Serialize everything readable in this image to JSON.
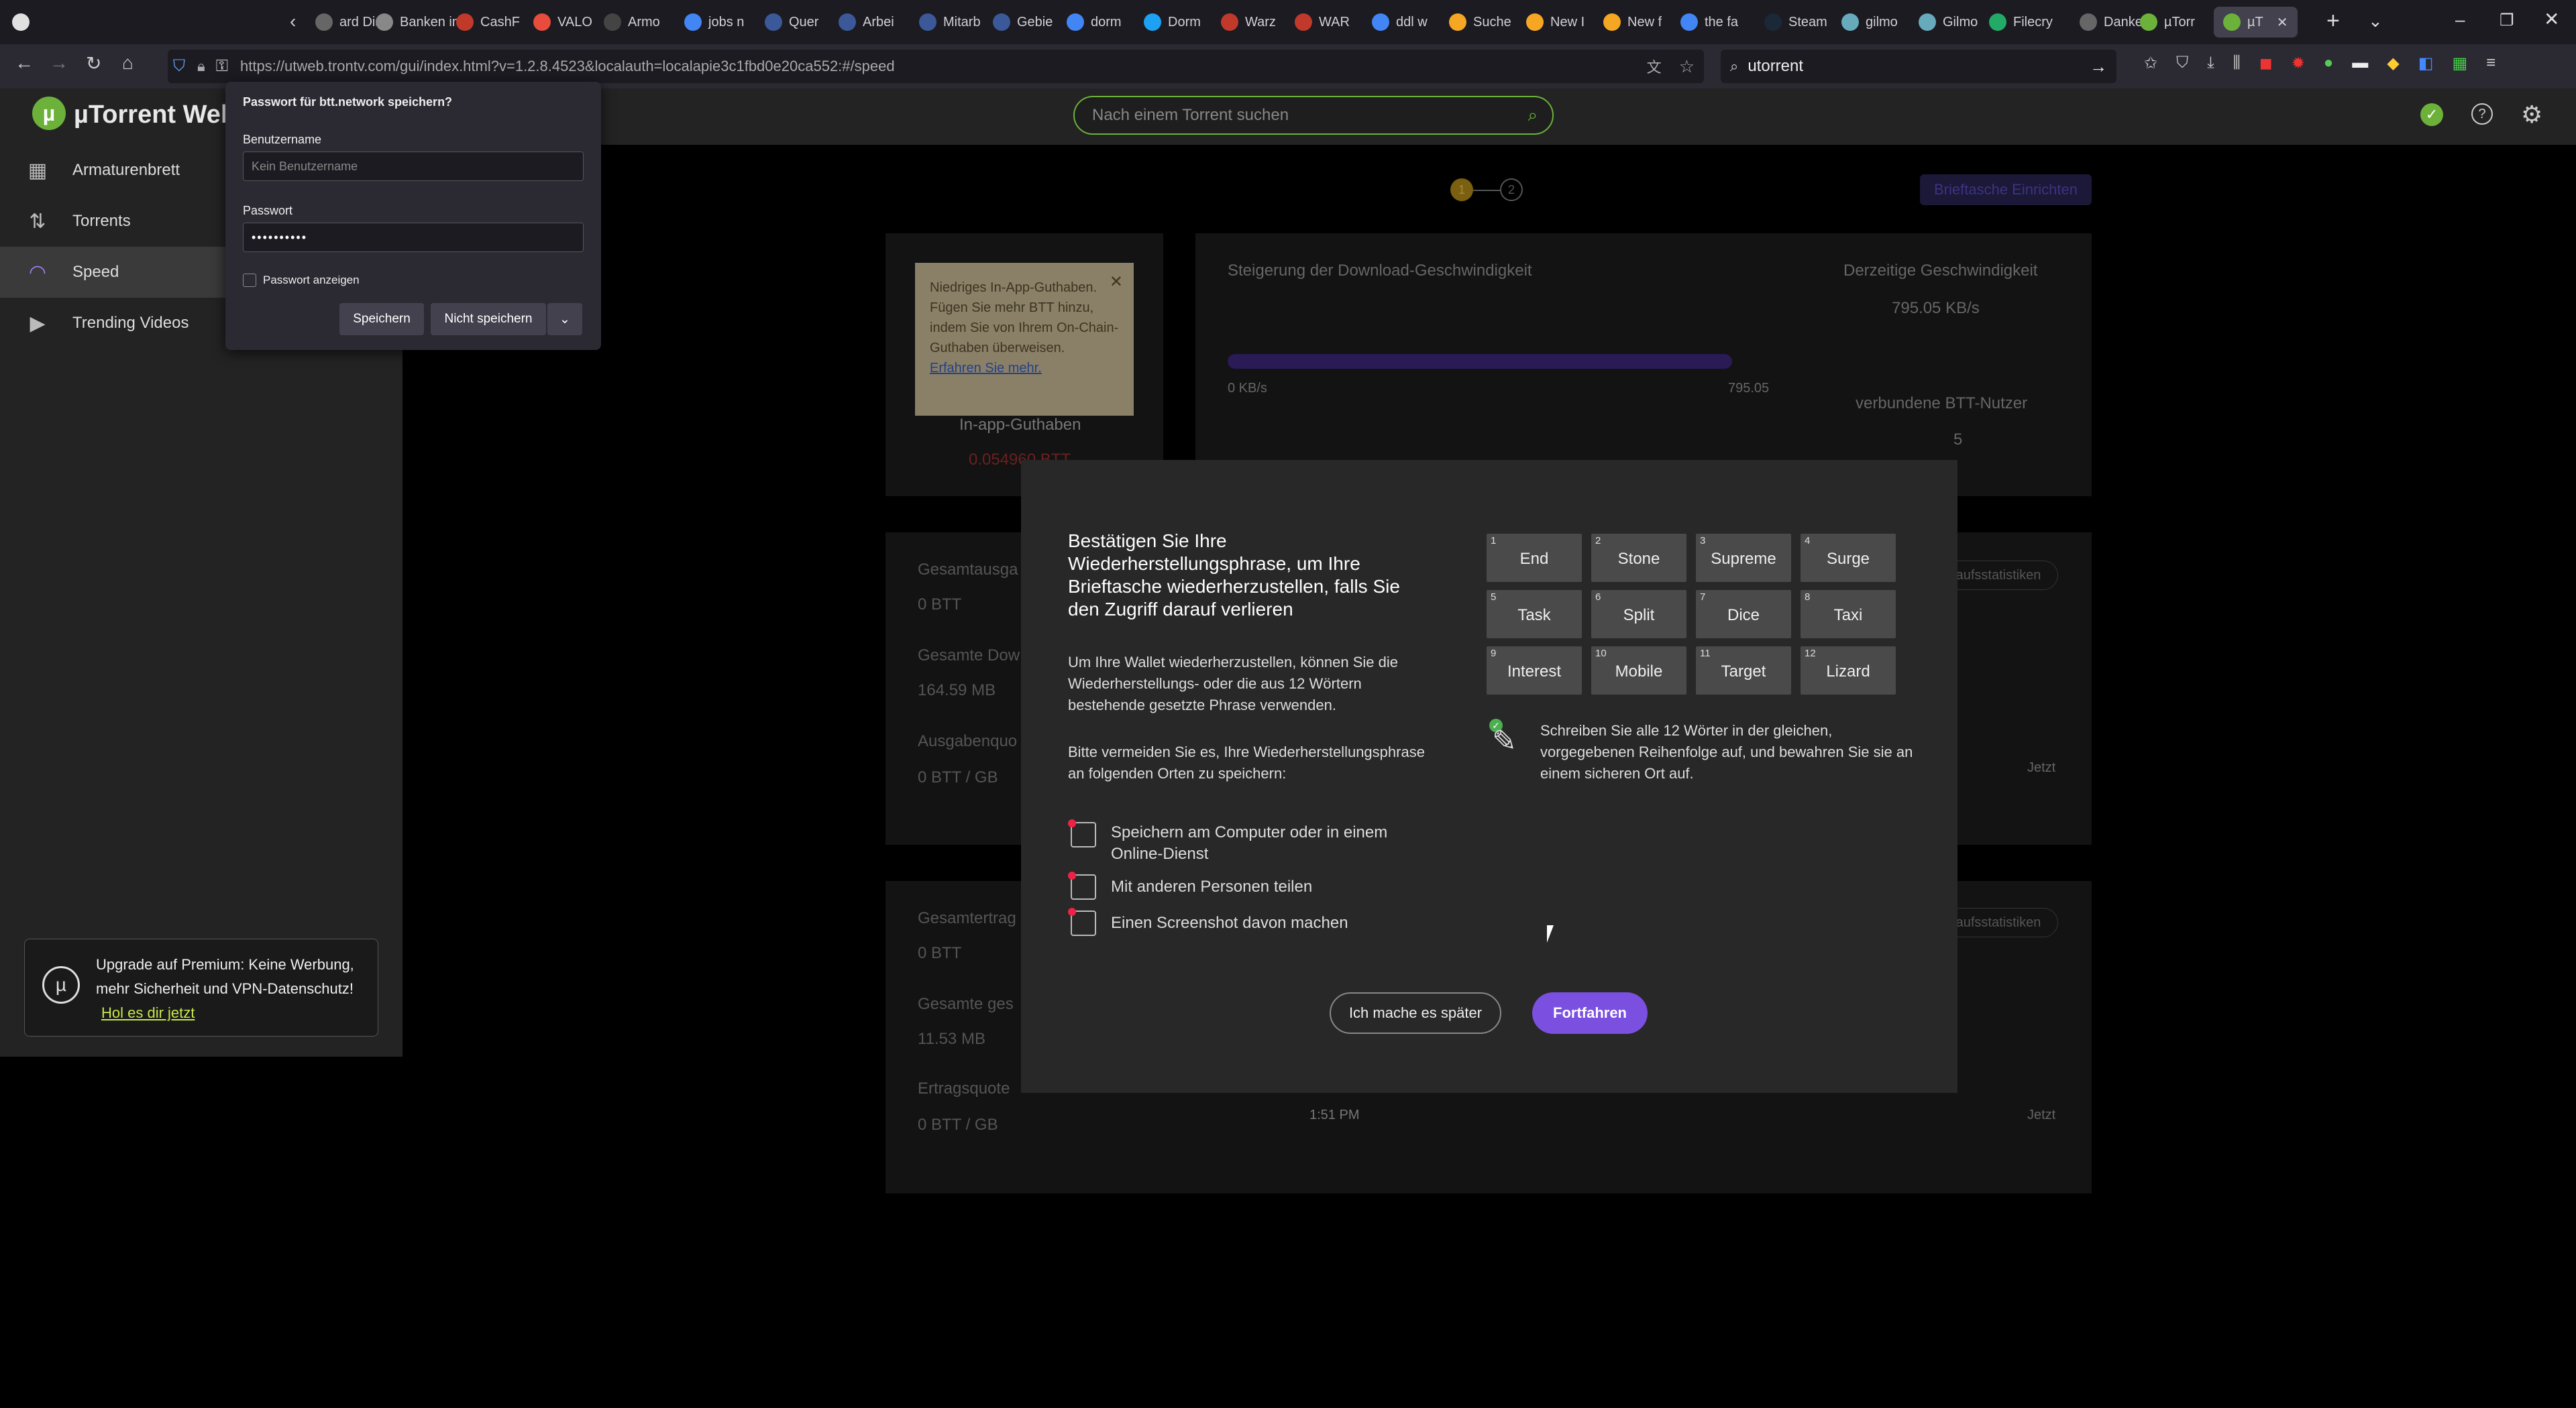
{
  "browser": {
    "tabs": [
      {
        "label": "ard Disk",
        "color": "#666"
      },
      {
        "label": "Banken in",
        "color": "#888"
      },
      {
        "label": "CashF",
        "color": "#c0392b"
      },
      {
        "label": "VALO",
        "color": "#e74c3c"
      },
      {
        "label": "Armo",
        "color": "#444"
      },
      {
        "label": "jobs n",
        "color": "#4285f4"
      },
      {
        "label": "Quer",
        "color": "#3b5998"
      },
      {
        "label": "Arbei",
        "color": "#3b5998"
      },
      {
        "label": "Mitarb",
        "color": "#3b5998"
      },
      {
        "label": "Gebie",
        "color": "#3b5998"
      },
      {
        "label": "dorm",
        "color": "#4285f4"
      },
      {
        "label": "Dorm",
        "color": "#1da1f2"
      },
      {
        "label": "Warz",
        "color": "#c0392b"
      },
      {
        "label": "WAR",
        "color": "#c0392b"
      },
      {
        "label": "ddl w",
        "color": "#4285f4"
      },
      {
        "label": "Suche",
        "color": "#f5a623"
      },
      {
        "label": "New I",
        "color": "#f5a623"
      },
      {
        "label": "New f",
        "color": "#f5a623"
      },
      {
        "label": "the fa",
        "color": "#4285f4"
      },
      {
        "label": "Steam",
        "color": "#1b2838"
      },
      {
        "label": "gilmo",
        "color": "#6ab"
      },
      {
        "label": "Gilmo",
        "color": "#6ab"
      },
      {
        "label": "Filecry",
        "color": "#2a6"
      },
      {
        "label": "Danke",
        "color": "#666"
      },
      {
        "label": "µTorr",
        "color": "#6cb23a"
      },
      {
        "label": "µT",
        "color": "#6cb23a"
      }
    ],
    "url": "https://utweb.trontv.com/gui/index.html?v=1.2.8.4523&localauth=localapie3c1fbd0e20ca552:#/speed",
    "search_value": "utorrent"
  },
  "app": {
    "logo": "µTorrent Web",
    "search_placeholder": "Nach einem Torrent suchen",
    "nav": [
      {
        "label": "Armaturenbrett",
        "icon": "grid-icon"
      },
      {
        "label": "Torrents",
        "icon": "arrows-updown-icon"
      },
      {
        "label": "Speed",
        "icon": "speed-icon"
      },
      {
        "label": "Trending Videos",
        "icon": "play-icon"
      }
    ],
    "premium": {
      "text": "Upgrade auf Premium: Keine Werbung, mehr Sicherheit und VPN-Datenschutz!",
      "link": "Hol es dir jetzt"
    },
    "steps": [
      "1",
      "2"
    ],
    "wallet_button": "Brieftasche Einrichten",
    "tooltip": {
      "text": "Niedriges In-App-Guthaben. Fügen Sie mehr BTT hinzu, indem Sie von Ihrem On-Chain-Guthaben überweisen.",
      "link": "Erfahren Sie mehr."
    },
    "inapp_label": "In-app-Guthaben",
    "inapp_value": "0.054960 BTT",
    "download_speed_title": "Steigerung der Download-Geschwindigkeit",
    "progress_left": "0 KB/s",
    "progress_right": "795.05",
    "current_speed_title": "Derzeitige Geschwindigkeit",
    "current_speed": "795.05 KB/s",
    "connected_title": "verbundene BTT-Nutzer",
    "connected_count": "5",
    "stats1": [
      {
        "label": "Gesamtausga",
        "value": "0  BTT"
      },
      {
        "label": "Gesamte Dow",
        "value": "164.59  MB"
      },
      {
        "label": "Ausgabenquo",
        "value": "0  BTT / GB"
      }
    ],
    "stats2": [
      {
        "label": "Gesamtertrag",
        "value": "0  BTT"
      },
      {
        "label": "Gesamte ges",
        "value": "11.53  MB"
      },
      {
        "label": "Ertragsquote",
        "value": "0  BTT / GB"
      }
    ],
    "stats_button": "aufsstatistiken",
    "now_label": "Jetzt",
    "time_label": "1:51 PM"
  },
  "password_popup": {
    "title": "Passwort für btt.network speichern?",
    "user_label": "Benutzername",
    "user_placeholder": "Kein Benutzername",
    "pass_label": "Passwort",
    "pass_value": "••••••••••",
    "show_label": "Passwort anzeigen",
    "save": "Speichern",
    "dont_save": "Nicht speichern"
  },
  "modal": {
    "title": "Bestätigen Sie Ihre Wiederherstellungsphrase, um Ihre Brieftasche wiederherzustellen, falls Sie den Zugriff darauf verlieren",
    "para1": "Um Ihre Wallet wiederherzustellen, können Sie die Wiederherstellungs- oder die aus 12 Wörtern bestehende gesetzte Phrase verwenden.",
    "para2": "Bitte vermeiden Sie es, Ihre Wiederherstellungsphrase an folgenden Orten zu speichern:",
    "bullets": [
      "Speichern am Computer oder in einem Online-Dienst",
      "Mit anderen Personen teilen",
      "Einen Screenshot davon machen"
    ],
    "words": [
      {
        "n": "1",
        "w": "End"
      },
      {
        "n": "2",
        "w": "Stone"
      },
      {
        "n": "3",
        "w": "Supreme"
      },
      {
        "n": "4",
        "w": "Surge"
      },
      {
        "n": "5",
        "w": "Task"
      },
      {
        "n": "6",
        "w": "Split"
      },
      {
        "n": "7",
        "w": "Dice"
      },
      {
        "n": "8",
        "w": "Taxi"
      },
      {
        "n": "9",
        "w": "Interest"
      },
      {
        "n": "10",
        "w": "Mobile"
      },
      {
        "n": "11",
        "w": "Target"
      },
      {
        "n": "12",
        "w": "Lizard"
      }
    ],
    "hint": "Schreiben Sie alle 12 Wörter in der gleichen, vorgegebenen Reihenfolge auf, und bewahren Sie sie an einem sicheren Ort auf.",
    "later": "Ich mache es später",
    "continue": "Fortfahren"
  },
  "colors": {
    "accent": "#7b4fe0",
    "green": "#6cb23a"
  }
}
